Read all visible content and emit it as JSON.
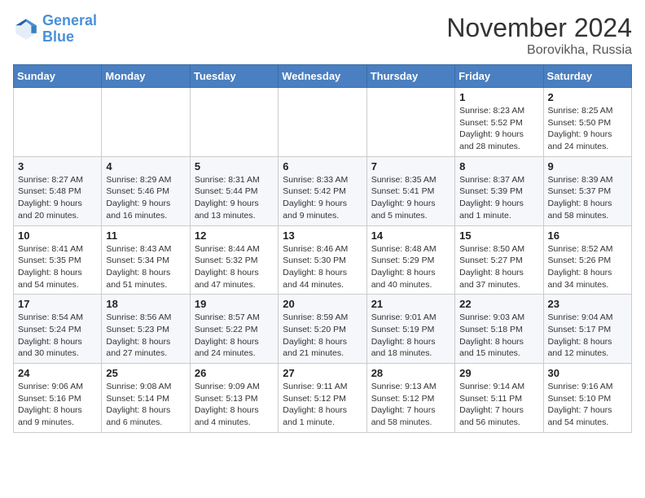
{
  "logo": {
    "line1": "General",
    "line2": "Blue"
  },
  "title": "November 2024",
  "subtitle": "Borovikha, Russia",
  "days_header": [
    "Sunday",
    "Monday",
    "Tuesday",
    "Wednesday",
    "Thursday",
    "Friday",
    "Saturday"
  ],
  "weeks": [
    [
      {
        "day": "",
        "info": ""
      },
      {
        "day": "",
        "info": ""
      },
      {
        "day": "",
        "info": ""
      },
      {
        "day": "",
        "info": ""
      },
      {
        "day": "",
        "info": ""
      },
      {
        "day": "1",
        "info": "Sunrise: 8:23 AM\nSunset: 5:52 PM\nDaylight: 9 hours and 28 minutes."
      },
      {
        "day": "2",
        "info": "Sunrise: 8:25 AM\nSunset: 5:50 PM\nDaylight: 9 hours and 24 minutes."
      }
    ],
    [
      {
        "day": "3",
        "info": "Sunrise: 8:27 AM\nSunset: 5:48 PM\nDaylight: 9 hours and 20 minutes."
      },
      {
        "day": "4",
        "info": "Sunrise: 8:29 AM\nSunset: 5:46 PM\nDaylight: 9 hours and 16 minutes."
      },
      {
        "day": "5",
        "info": "Sunrise: 8:31 AM\nSunset: 5:44 PM\nDaylight: 9 hours and 13 minutes."
      },
      {
        "day": "6",
        "info": "Sunrise: 8:33 AM\nSunset: 5:42 PM\nDaylight: 9 hours and 9 minutes."
      },
      {
        "day": "7",
        "info": "Sunrise: 8:35 AM\nSunset: 5:41 PM\nDaylight: 9 hours and 5 minutes."
      },
      {
        "day": "8",
        "info": "Sunrise: 8:37 AM\nSunset: 5:39 PM\nDaylight: 9 hours and 1 minute."
      },
      {
        "day": "9",
        "info": "Sunrise: 8:39 AM\nSunset: 5:37 PM\nDaylight: 8 hours and 58 minutes."
      }
    ],
    [
      {
        "day": "10",
        "info": "Sunrise: 8:41 AM\nSunset: 5:35 PM\nDaylight: 8 hours and 54 minutes."
      },
      {
        "day": "11",
        "info": "Sunrise: 8:43 AM\nSunset: 5:34 PM\nDaylight: 8 hours and 51 minutes."
      },
      {
        "day": "12",
        "info": "Sunrise: 8:44 AM\nSunset: 5:32 PM\nDaylight: 8 hours and 47 minutes."
      },
      {
        "day": "13",
        "info": "Sunrise: 8:46 AM\nSunset: 5:30 PM\nDaylight: 8 hours and 44 minutes."
      },
      {
        "day": "14",
        "info": "Sunrise: 8:48 AM\nSunset: 5:29 PM\nDaylight: 8 hours and 40 minutes."
      },
      {
        "day": "15",
        "info": "Sunrise: 8:50 AM\nSunset: 5:27 PM\nDaylight: 8 hours and 37 minutes."
      },
      {
        "day": "16",
        "info": "Sunrise: 8:52 AM\nSunset: 5:26 PM\nDaylight: 8 hours and 34 minutes."
      }
    ],
    [
      {
        "day": "17",
        "info": "Sunrise: 8:54 AM\nSunset: 5:24 PM\nDaylight: 8 hours and 30 minutes."
      },
      {
        "day": "18",
        "info": "Sunrise: 8:56 AM\nSunset: 5:23 PM\nDaylight: 8 hours and 27 minutes."
      },
      {
        "day": "19",
        "info": "Sunrise: 8:57 AM\nSunset: 5:22 PM\nDaylight: 8 hours and 24 minutes."
      },
      {
        "day": "20",
        "info": "Sunrise: 8:59 AM\nSunset: 5:20 PM\nDaylight: 8 hours and 21 minutes."
      },
      {
        "day": "21",
        "info": "Sunrise: 9:01 AM\nSunset: 5:19 PM\nDaylight: 8 hours and 18 minutes."
      },
      {
        "day": "22",
        "info": "Sunrise: 9:03 AM\nSunset: 5:18 PM\nDaylight: 8 hours and 15 minutes."
      },
      {
        "day": "23",
        "info": "Sunrise: 9:04 AM\nSunset: 5:17 PM\nDaylight: 8 hours and 12 minutes."
      }
    ],
    [
      {
        "day": "24",
        "info": "Sunrise: 9:06 AM\nSunset: 5:16 PM\nDaylight: 8 hours and 9 minutes."
      },
      {
        "day": "25",
        "info": "Sunrise: 9:08 AM\nSunset: 5:14 PM\nDaylight: 8 hours and 6 minutes."
      },
      {
        "day": "26",
        "info": "Sunrise: 9:09 AM\nSunset: 5:13 PM\nDaylight: 8 hours and 4 minutes."
      },
      {
        "day": "27",
        "info": "Sunrise: 9:11 AM\nSunset: 5:12 PM\nDaylight: 8 hours and 1 minute."
      },
      {
        "day": "28",
        "info": "Sunrise: 9:13 AM\nSunset: 5:12 PM\nDaylight: 7 hours and 58 minutes."
      },
      {
        "day": "29",
        "info": "Sunrise: 9:14 AM\nSunset: 5:11 PM\nDaylight: 7 hours and 56 minutes."
      },
      {
        "day": "30",
        "info": "Sunrise: 9:16 AM\nSunset: 5:10 PM\nDaylight: 7 hours and 54 minutes."
      }
    ]
  ]
}
